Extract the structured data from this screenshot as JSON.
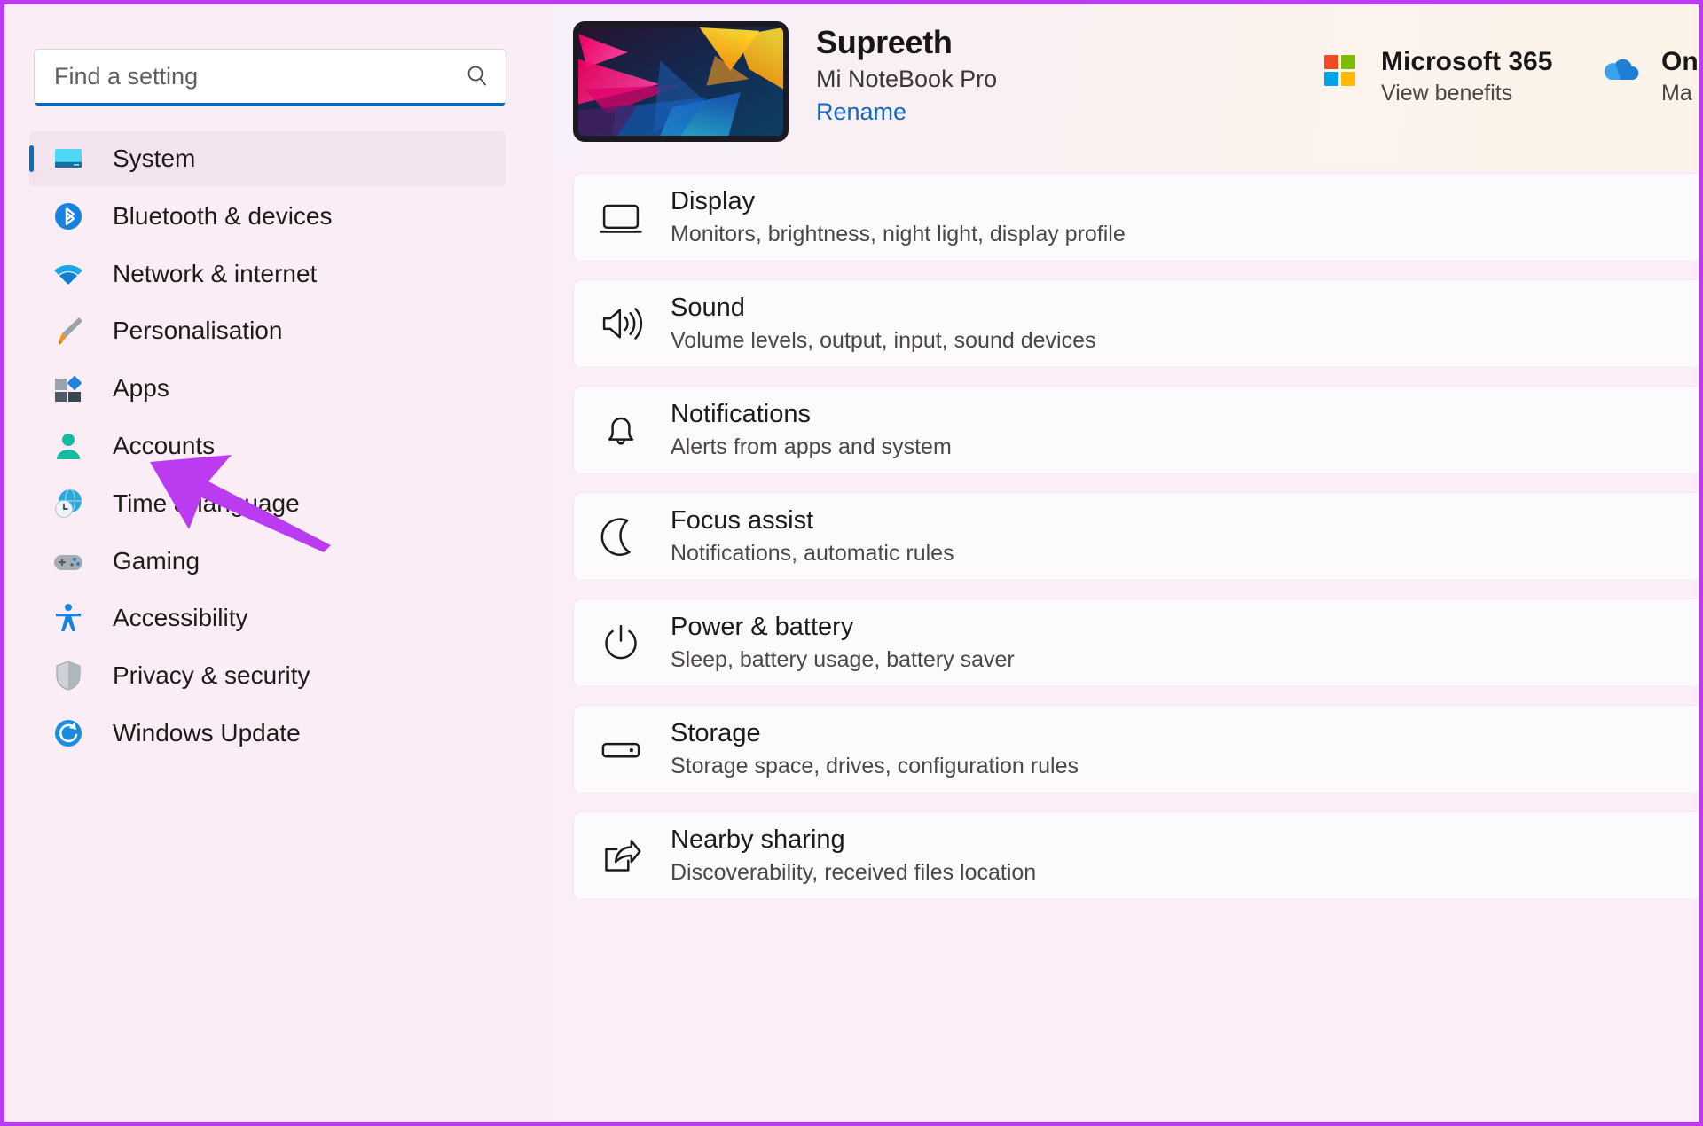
{
  "window": {
    "app": "Settings",
    "accent_color": "#0a6cbd",
    "annotation_color": "#bb3cf0",
    "background_color": "#fbedf6"
  },
  "search": {
    "placeholder": "Find a setting",
    "value": "",
    "icon": "search-icon"
  },
  "sidebar": {
    "items": [
      {
        "label": "System",
        "icon": "system-monitor-icon",
        "selected": true
      },
      {
        "label": "Bluetooth & devices",
        "icon": "bluetooth-icon",
        "selected": false
      },
      {
        "label": "Network & internet",
        "icon": "wifi-icon",
        "selected": false
      },
      {
        "label": "Personalisation",
        "icon": "paintbrush-icon",
        "selected": false
      },
      {
        "label": "Apps",
        "icon": "apps-grid-icon",
        "selected": false
      },
      {
        "label": "Accounts",
        "icon": "person-icon",
        "selected": false
      },
      {
        "label": "Time & language",
        "icon": "clock-globe-icon",
        "selected": false
      },
      {
        "label": "Gaming",
        "icon": "gamepad-icon",
        "selected": false
      },
      {
        "label": "Accessibility",
        "icon": "accessibility-icon",
        "selected": false
      },
      {
        "label": "Privacy & security",
        "icon": "shield-icon",
        "selected": false
      },
      {
        "label": "Windows Update",
        "icon": "update-refresh-icon",
        "selected": false
      }
    ]
  },
  "annotation": {
    "type": "arrow",
    "points_to": "Apps",
    "color": "#bb3cf0"
  },
  "hero": {
    "device_name": "Supreeth",
    "device_model": "Mi NoteBook Pro",
    "rename_label": "Rename",
    "device_thumbnail": "abstract-wallpaper-thumbnail",
    "cards": [
      {
        "title": "Microsoft 365",
        "subtitle": "View benefits",
        "icon": "microsoft-logo-icon"
      },
      {
        "title": "On",
        "subtitle": "Ma",
        "icon": "onedrive-cloud-icon"
      }
    ]
  },
  "main": {
    "settings": [
      {
        "title": "Display",
        "subtitle": "Monitors, brightness, night light, display profile",
        "icon": "monitor-icon"
      },
      {
        "title": "Sound",
        "subtitle": "Volume levels, output, input, sound devices",
        "icon": "speaker-icon"
      },
      {
        "title": "Notifications",
        "subtitle": "Alerts from apps and system",
        "icon": "bell-icon"
      },
      {
        "title": "Focus assist",
        "subtitle": "Notifications, automatic rules",
        "icon": "moon-icon"
      },
      {
        "title": "Power & battery",
        "subtitle": "Sleep, battery usage, battery saver",
        "icon": "power-icon"
      },
      {
        "title": "Storage",
        "subtitle": "Storage space, drives, configuration rules",
        "icon": "harddrive-icon"
      },
      {
        "title": "Nearby sharing",
        "subtitle": "Discoverability, received files location",
        "icon": "share-icon"
      }
    ]
  }
}
